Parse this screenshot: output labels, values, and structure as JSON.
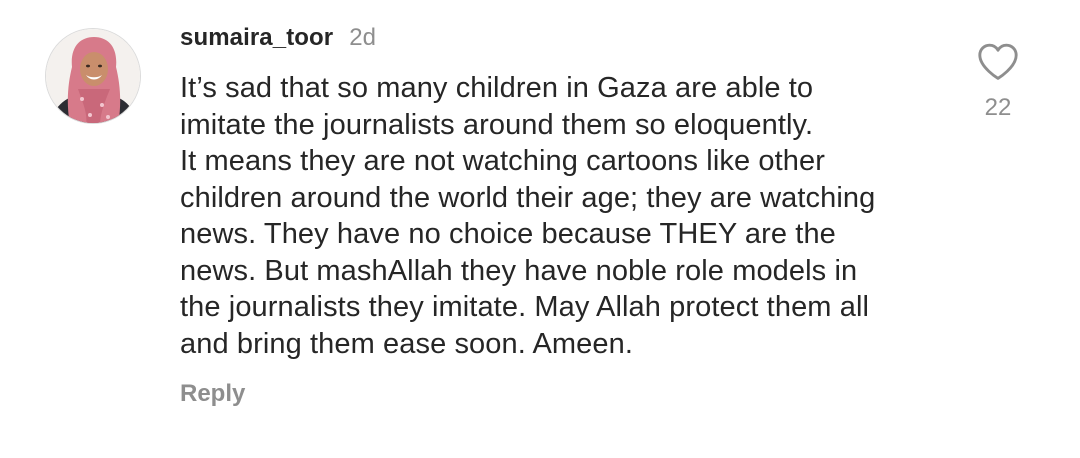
{
  "comment": {
    "username": "sumaira_toor",
    "timestamp": "2d",
    "text_lines": [
      "It’s sad that so many children in Gaza are able to",
      "imitate the journalists around them so eloquently.",
      "It means they are not watching cartoons like other",
      "children around the world their age; they are watching",
      "news. They have no choice because THEY are the",
      "news. But mashAllah they have noble role models in",
      "the journalists they imitate. May Allah protect them all",
      "and bring them ease soon. Ameen."
    ],
    "reply_label": "Reply",
    "like_count": "22",
    "like_icon": "heart-outline-icon"
  },
  "colors": {
    "text": "#262626",
    "secondary": "#8e8e8e",
    "background": "#ffffff"
  }
}
